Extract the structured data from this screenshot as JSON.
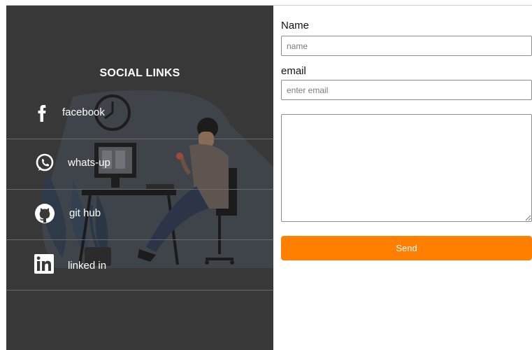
{
  "social": {
    "title": "SOCIAL LINKS",
    "items": [
      {
        "label": "facebook",
        "icon": "facebook-icon"
      },
      {
        "label": "whats-up",
        "icon": "whatsapp-icon"
      },
      {
        "label": "git hub",
        "icon": "github-icon"
      },
      {
        "label": "linked in",
        "icon": "linkedin-icon"
      }
    ]
  },
  "form": {
    "name_label": "Name",
    "name_placeholder": "name",
    "email_label": "email",
    "email_placeholder": "enter email",
    "message_placeholder": "",
    "send_label": "Send"
  },
  "colors": {
    "panel_bg": "#383838",
    "accent": "#ff7f00",
    "text_light": "#ffffff"
  }
}
